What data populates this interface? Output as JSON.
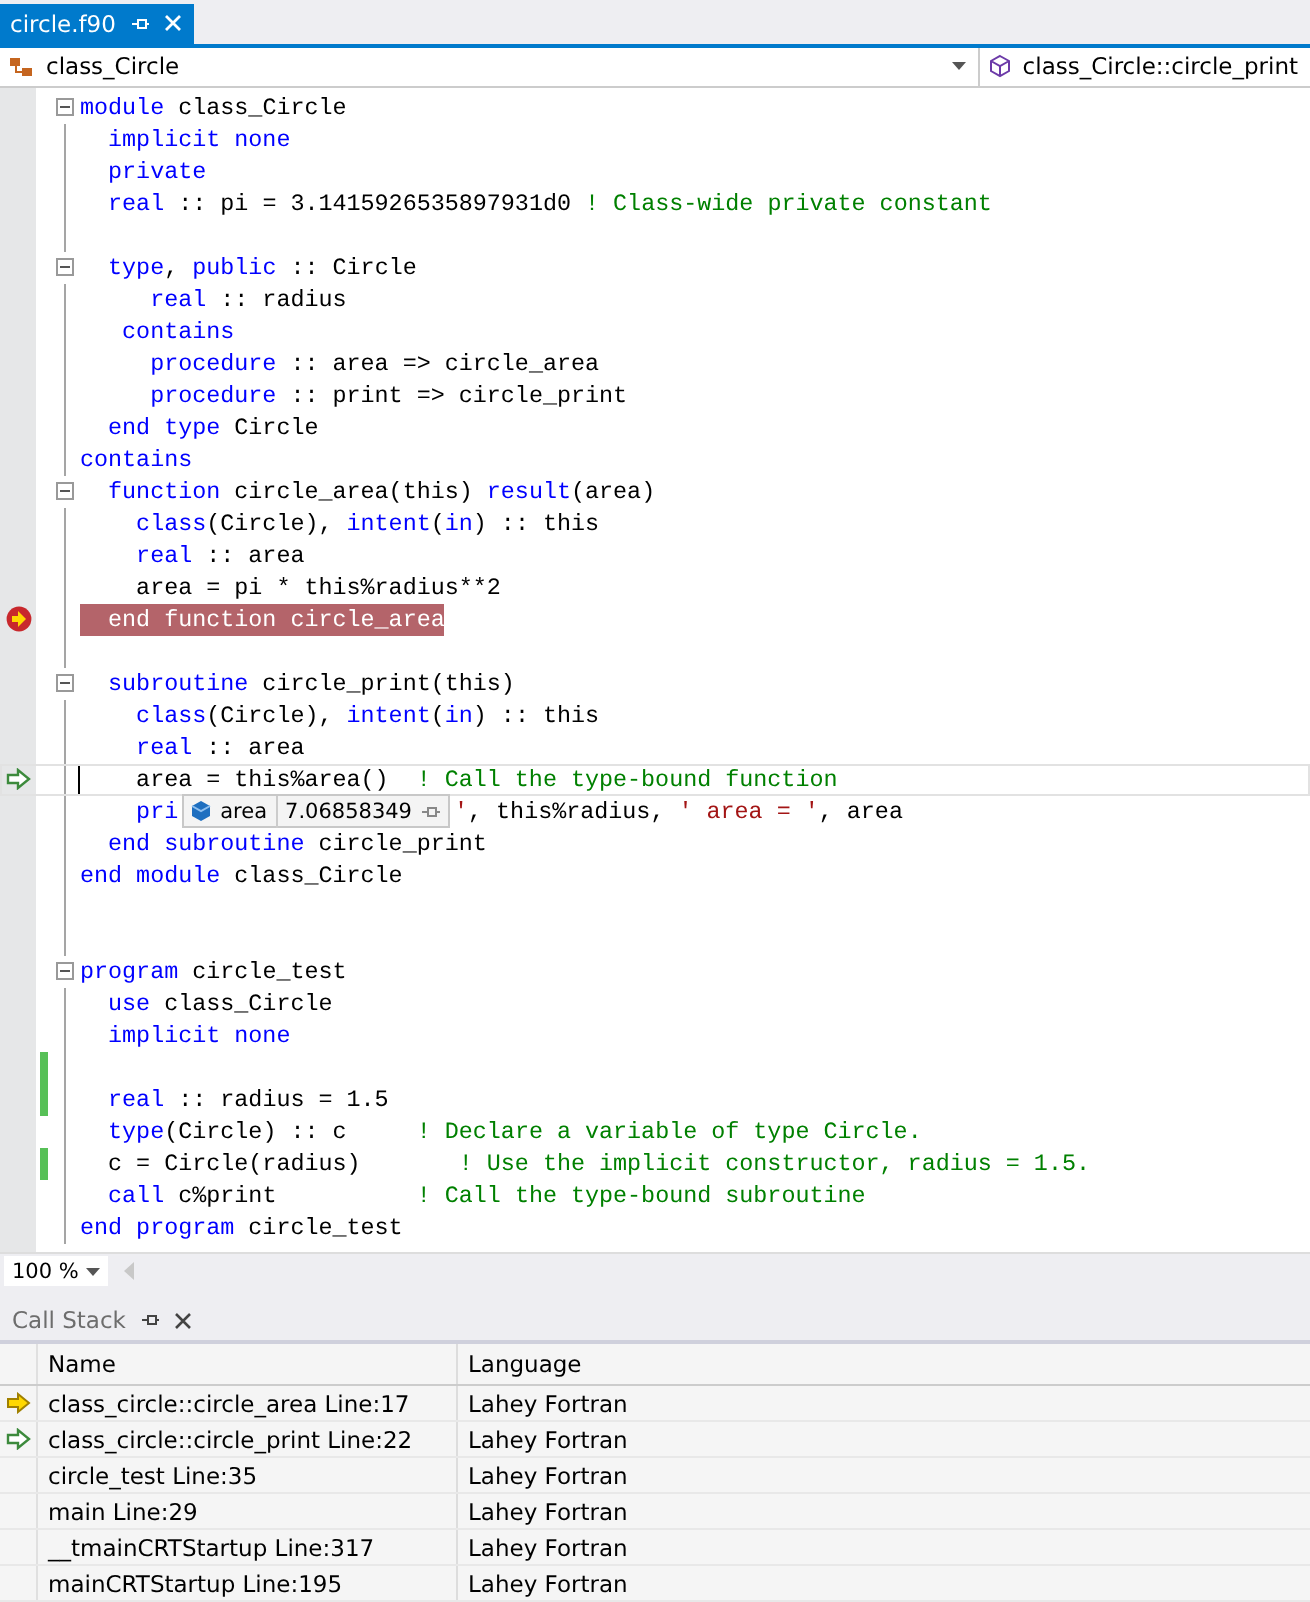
{
  "document_tab": {
    "title": "circle.f90",
    "selected": true
  },
  "nav_bar": {
    "scope": "class_Circle",
    "member": "class_Circle::circle_print"
  },
  "code_lines": [
    {
      "fold": true,
      "segments": [
        {
          "kind": "keyword",
          "text": "module"
        },
        {
          "kind": "plain",
          "text": " class_Circle"
        }
      ]
    },
    {
      "segments": [
        {
          "kind": "keyword",
          "text": "  implicit none"
        }
      ]
    },
    {
      "segments": [
        {
          "kind": "keyword",
          "text": "  private"
        }
      ]
    },
    {
      "segments": [
        {
          "kind": "keyword",
          "text": "  real"
        },
        {
          "kind": "plain",
          "text": " :: pi = 3.1415926535897931d0 "
        },
        {
          "kind": "comment",
          "text": "! Class-wide private constant"
        }
      ]
    },
    {
      "kind": "blank"
    },
    {
      "fold": true,
      "segments": [
        {
          "kind": "keyword",
          "text": "  type"
        },
        {
          "kind": "plain",
          "text": ", "
        },
        {
          "kind": "keyword",
          "text": "public"
        },
        {
          "kind": "plain",
          "text": " :: Circle"
        }
      ]
    },
    {
      "segments": [
        {
          "kind": "keyword",
          "text": "     real"
        },
        {
          "kind": "plain",
          "text": " :: radius"
        }
      ]
    },
    {
      "segments": [
        {
          "kind": "keyword",
          "text": "   contains"
        }
      ]
    },
    {
      "segments": [
        {
          "kind": "keyword",
          "text": "     procedure"
        },
        {
          "kind": "plain",
          "text": " :: area => circle_area"
        }
      ]
    },
    {
      "segments": [
        {
          "kind": "keyword",
          "text": "     procedure"
        },
        {
          "kind": "plain",
          "text": " :: print => circle_print"
        }
      ]
    },
    {
      "segments": [
        {
          "kind": "keyword",
          "text": "  end type"
        },
        {
          "kind": "plain",
          "text": " Circle"
        }
      ]
    },
    {
      "segments": [
        {
          "kind": "keyword",
          "text": "contains"
        }
      ]
    },
    {
      "fold": true,
      "segments": [
        {
          "kind": "keyword",
          "text": "  function"
        },
        {
          "kind": "plain",
          "text": " circle_area(this) "
        },
        {
          "kind": "keyword",
          "text": "result"
        },
        {
          "kind": "plain",
          "text": "(area)"
        }
      ]
    },
    {
      "segments": [
        {
          "kind": "keyword",
          "text": "    class"
        },
        {
          "kind": "plain",
          "text": "(Circle), "
        },
        {
          "kind": "keyword",
          "text": "intent"
        },
        {
          "kind": "plain",
          "text": "("
        },
        {
          "kind": "keyword",
          "text": "in"
        },
        {
          "kind": "plain",
          "text": ") :: this"
        }
      ]
    },
    {
      "segments": [
        {
          "kind": "keyword",
          "text": "    real"
        },
        {
          "kind": "plain",
          "text": " :: area"
        }
      ]
    },
    {
      "segments": [
        {
          "kind": "plain",
          "text": "    area = pi * this%radius**2"
        }
      ]
    },
    {
      "kind": "current",
      "segments": [
        {
          "kind": "keyword",
          "text": "  end function"
        },
        {
          "kind": "plain",
          "text": " circle_area"
        }
      ]
    },
    {
      "kind": "blank"
    },
    {
      "fold": true,
      "segments": [
        {
          "kind": "keyword",
          "text": "  subroutine"
        },
        {
          "kind": "plain",
          "text": " circle_print(this)"
        }
      ]
    },
    {
      "segments": [
        {
          "kind": "keyword",
          "text": "    class"
        },
        {
          "kind": "plain",
          "text": "(Circle), "
        },
        {
          "kind": "keyword",
          "text": "intent"
        },
        {
          "kind": "plain",
          "text": "("
        },
        {
          "kind": "keyword",
          "text": "in"
        },
        {
          "kind": "plain",
          "text": ") :: this"
        }
      ]
    },
    {
      "segments": [
        {
          "kind": "keyword",
          "text": "    real"
        },
        {
          "kind": "plain",
          "text": " :: area"
        }
      ]
    },
    {
      "kind": "caller",
      "caret": true,
      "segments": [
        {
          "kind": "plain",
          "text": "    area = this%area()  "
        },
        {
          "kind": "comment",
          "text": "! Call the type-bound function"
        }
      ]
    },
    {
      "segments": [
        {
          "kind": "keyword",
          "text": "    pri"
        },
        {
          "kind": "datatip",
          "name": "area",
          "value": "7.06858349"
        },
        {
          "kind": "string",
          "text": "'"
        },
        {
          "kind": "plain",
          "text": ", this%radius, "
        },
        {
          "kind": "string",
          "text": "' area = '"
        },
        {
          "kind": "plain",
          "text": ", area"
        }
      ]
    },
    {
      "segments": [
        {
          "kind": "keyword",
          "text": "  end subroutine"
        },
        {
          "kind": "plain",
          "text": " circle_print"
        }
      ]
    },
    {
      "segments": [
        {
          "kind": "keyword",
          "text": "end module"
        },
        {
          "kind": "plain",
          "text": " class_Circle"
        }
      ]
    },
    {
      "kind": "blank"
    },
    {
      "kind": "blank"
    },
    {
      "fold": true,
      "segments": [
        {
          "kind": "keyword",
          "text": "program"
        },
        {
          "kind": "plain",
          "text": " circle_test"
        }
      ]
    },
    {
      "segments": [
        {
          "kind": "keyword",
          "text": "  use"
        },
        {
          "kind": "plain",
          "text": " class_Circle"
        }
      ]
    },
    {
      "segments": [
        {
          "kind": "keyword",
          "text": "  implicit none"
        }
      ]
    },
    {
      "kind": "blank",
      "changed": true
    },
    {
      "changed": true,
      "segments": [
        {
          "kind": "keyword",
          "text": "  real"
        },
        {
          "kind": "plain",
          "text": " :: radius = 1.5"
        }
      ]
    },
    {
      "segments": [
        {
          "kind": "keyword",
          "text": "  type"
        },
        {
          "kind": "plain",
          "text": "(Circle) :: c     "
        },
        {
          "kind": "comment",
          "text": "! Declare a variable of type Circle."
        }
      ]
    },
    {
      "changed": true,
      "segments": [
        {
          "kind": "plain",
          "text": "  c = Circle(radius)       "
        },
        {
          "kind": "comment",
          "text": "! Use the implicit constructor, radius = 1.5."
        }
      ]
    },
    {
      "segments": [
        {
          "kind": "keyword",
          "text": "  call"
        },
        {
          "kind": "plain",
          "text": " c%print          "
        },
        {
          "kind": "comment",
          "text": "! Call the type-bound subroutine"
        }
      ]
    },
    {
      "segments": [
        {
          "kind": "keyword",
          "text": "end program"
        },
        {
          "kind": "plain",
          "text": " circle_test"
        }
      ]
    }
  ],
  "zoom": "100 %",
  "call_stack": {
    "title": "Call Stack",
    "selected": false,
    "columns": [
      "Name",
      "Language"
    ],
    "rows": [
      {
        "kind": "current",
        "name": "class_circle::circle_area Line:17",
        "language": "Lahey Fortran"
      },
      {
        "kind": "caller",
        "name": "class_circle::circle_print Line:22",
        "language": "Lahey Fortran"
      },
      {
        "name": "circle_test Line:35",
        "language": "Lahey Fortran"
      },
      {
        "name": "main Line:29",
        "language": "Lahey Fortran"
      },
      {
        "name": "__tmainCRTStartup Line:317",
        "language": "Lahey Fortran"
      },
      {
        "name": "mainCRTStartup Line:195",
        "language": "Lahey Fortran"
      }
    ]
  }
}
